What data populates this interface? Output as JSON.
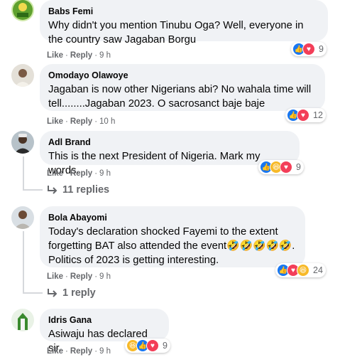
{
  "comments": [
    {
      "author": "Babs Femi",
      "text": "Why didn't you mention Tinubu Oga? Well, everyone in the country saw Jagaban Borgu",
      "like": "Like",
      "reply": "Reply",
      "time": "9 h",
      "reaction_count": "9",
      "reaction_icons": [
        "like-icon",
        "love-icon"
      ]
    },
    {
      "author": "Omodayo Olawoye",
      "text": "Jagaban is now other Nigerians abi? No wahala time will tell........Jagaban 2023. O sacrosanct baje baje",
      "like": "Like",
      "reply": "Reply",
      "time": "10 h",
      "reaction_count": "12",
      "reaction_icons": [
        "like-icon",
        "love-icon"
      ]
    },
    {
      "author": "Adl Brand",
      "text": "This is the next President of Nigeria. Mark my words.",
      "like": "Like",
      "reply": "Reply",
      "time": "9 h",
      "reaction_count": "9",
      "reaction_icons": [
        "like-icon",
        "haha-icon",
        "love-icon"
      ],
      "replies_label": "11 replies"
    },
    {
      "author": "Bola Abayomi",
      "text": "Today's declaration shocked Fayemi to the extent forgetting BAT also attended the event🤣🤣🤣🤣🤣. Politics of 2023 is getting interesting.",
      "like": "Like",
      "reply": "Reply",
      "time": "9 h",
      "reaction_count": "24",
      "reaction_icons": [
        "like-icon",
        "love-icon",
        "haha-icon"
      ],
      "replies_label": "1 reply"
    },
    {
      "author": "Idris Gana",
      "text": "Asiwaju has declared sir.",
      "like": "Like",
      "reply": "Reply",
      "time": "9 h",
      "reaction_count": "9",
      "reaction_icons": [
        "haha-icon",
        "like-icon",
        "love-icon"
      ]
    }
  ],
  "colors": {
    "bubble": "#f0f2f5",
    "meta": "#65676b",
    "like": "#1877f2",
    "love": "#f33e58",
    "haha": "#f7b928"
  },
  "avatar_icons": [
    "avatar-icon",
    "avatar-icon",
    "avatar-icon",
    "avatar-icon",
    "avatar-icon"
  ]
}
